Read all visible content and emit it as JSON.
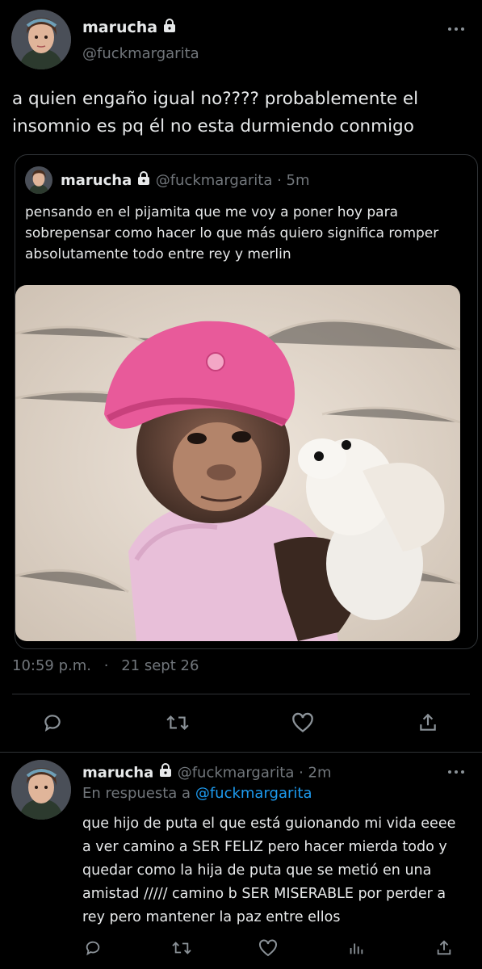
{
  "main_tweet": {
    "display_name": "marucha",
    "handle": "@fuckmargarita",
    "text": "a quien engaño igual no???? probablemente el insomnio es pq él no esta durmiendo conmigo",
    "timestamp": "10:59 p.m.",
    "separator": "·",
    "date": "21 sept 26",
    "more_icon": "more-horizontal-icon"
  },
  "quoted_tweet": {
    "display_name": "marucha",
    "handle": "@fuckmargarita",
    "time_ago": "· 5m",
    "text": "pensando en el pijamita que me voy a poner hoy para sobrepensar como hacer lo que más quiero significa romper absolutamente todo entre rey y merlin",
    "image": "baby-chimpanzee-in-pink-hat-hugging-plush-toy"
  },
  "actions": [
    "reply-icon",
    "retweet-icon",
    "like-icon",
    "share-icon"
  ],
  "reply_tweet": {
    "display_name": "marucha",
    "handle": "@fuckmargarita",
    "time_ago": "· 2m",
    "reply_prefix": "En respuesta a",
    "reply_to": "@fuckmargarita",
    "text": "que hijo de puta el que está guionando mi vida eeee a ver camino a SER FELIZ pero hacer mierda todo y quedar como la hija de puta que se metió en una amistad ///// camino b SER MISERABLE por perder a rey pero mantener la paz entre ellos",
    "more_icon": "more-horizontal-icon",
    "actions": [
      "reply-icon",
      "retweet-icon",
      "like-icon",
      "analytics-icon",
      "share-icon"
    ]
  },
  "colors": {
    "background": "#000000",
    "text": "#e7e9ea",
    "muted": "#71767b",
    "link": "#1d9bf0",
    "divider": "#2f3336"
  }
}
